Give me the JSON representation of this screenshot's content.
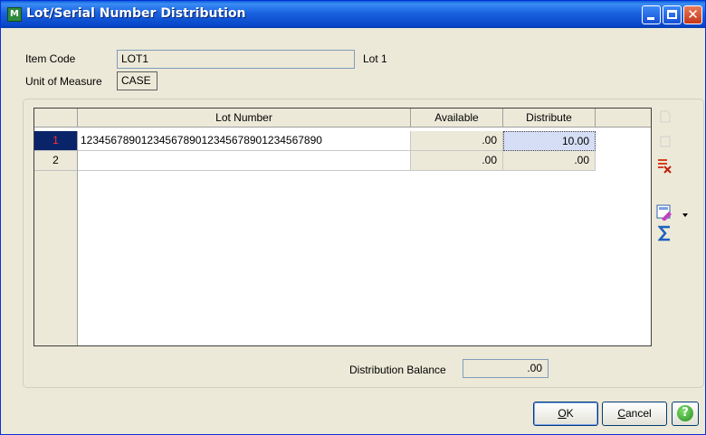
{
  "window": {
    "title": "Lot/Serial Number Distribution",
    "app_icon_glyph": "M"
  },
  "header": {
    "item_code_label": "Item Code",
    "item_code_value": "LOT1",
    "item_description": "Lot 1",
    "uom_label": "Unit of Measure",
    "uom_value": "CASE"
  },
  "grid": {
    "columns": [
      "Lot Number",
      "Available",
      "Distribute"
    ],
    "rows": [
      {
        "row_number": "1",
        "lot_number": "1234567890123456789012345678901234567890",
        "available": ".00",
        "distribute": "10.00",
        "selected": true
      },
      {
        "row_number": "2",
        "lot_number": "",
        "available": ".00",
        "distribute": ".00",
        "selected": false
      }
    ]
  },
  "distribution_balance": {
    "label": "Distribution Balance",
    "value": ".00"
  },
  "buttons": {
    "ok_label": "OK",
    "ok_underline": "O",
    "ok_rest": "K",
    "cancel_label": "Cancel",
    "cancel_underline": "C",
    "cancel_rest": "ancel"
  },
  "icons": [
    "copy-icon",
    "paste-icon",
    "delete-row-icon",
    "customize-icon",
    "dropdown-arrow-icon",
    "sum-icon",
    "help-icon"
  ],
  "colors": {
    "title_bar": "#0a5fd8",
    "selected_row_indicator": "#0a246a",
    "selected_row_number": "#ff3030",
    "delete_icon": "#d83020",
    "sum_icon": "#2060c0"
  }
}
